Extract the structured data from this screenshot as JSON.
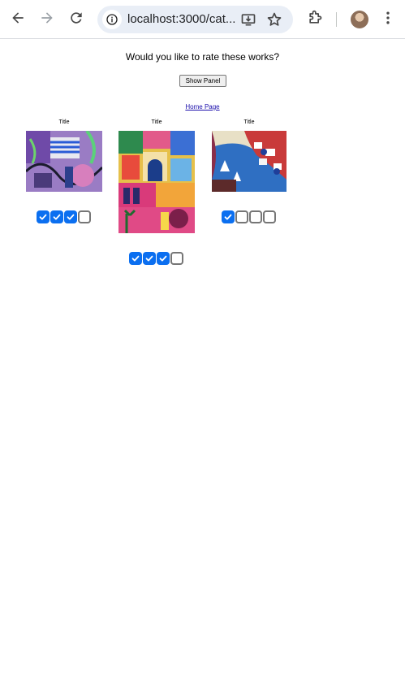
{
  "browser": {
    "url": "localhost:3000/cat...",
    "icons": [
      "back-arrow-icon",
      "forward-arrow-icon",
      "reload-icon",
      "site-info-icon",
      "install-app-icon",
      "bookmark-star-icon",
      "extensions-icon",
      "profile-avatar",
      "more-menu-icon"
    ]
  },
  "page": {
    "prompt": "Would you like to rate these works?",
    "show_panel_label": "Show Panel",
    "home_link": "Home Page",
    "artworks": [
      {
        "title": "Title",
        "rating": 3,
        "max": 4
      },
      {
        "title": "Title",
        "rating": 3,
        "max": 4
      },
      {
        "title": "Title",
        "rating": 1,
        "max": 4
      }
    ]
  },
  "colors": {
    "checked": "#0b6ff0",
    "unchecked_border": "#767676",
    "link": "#1a0dab"
  }
}
